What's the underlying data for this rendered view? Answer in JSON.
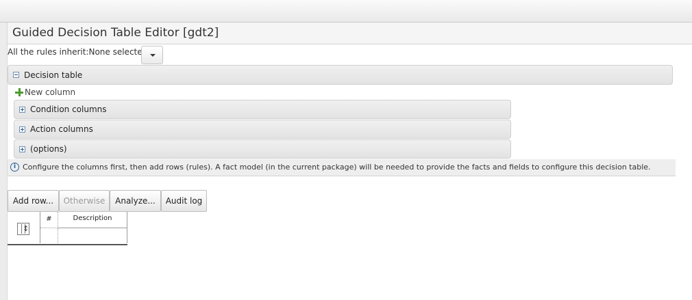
{
  "editor": {
    "title": "Guided Decision Table Editor [gdt2]",
    "inherit_label": "All the rules inherit:None selected"
  },
  "sections": {
    "decision_table": "Decision table",
    "new_column": "New column",
    "condition_columns": "Condition columns",
    "action_columns": "Action columns",
    "options": "(options)"
  },
  "info": {
    "icon": "info-icon",
    "text": "Configure the columns first, then add rows (rules). A fact model (in the current package) will be needed to provide the facts and fields to configure this decision table."
  },
  "toolbar": {
    "add_row": "Add row...",
    "otherwise": "Otherwise",
    "analyze": "Analyze...",
    "audit_log": "Audit log"
  },
  "table": {
    "headers": [
      "#",
      "Description"
    ]
  },
  "colors": {
    "accent_plus": "#4b9b2c",
    "info_blue": "#2a5e9c",
    "disabled_text": "#9a9a9a"
  }
}
